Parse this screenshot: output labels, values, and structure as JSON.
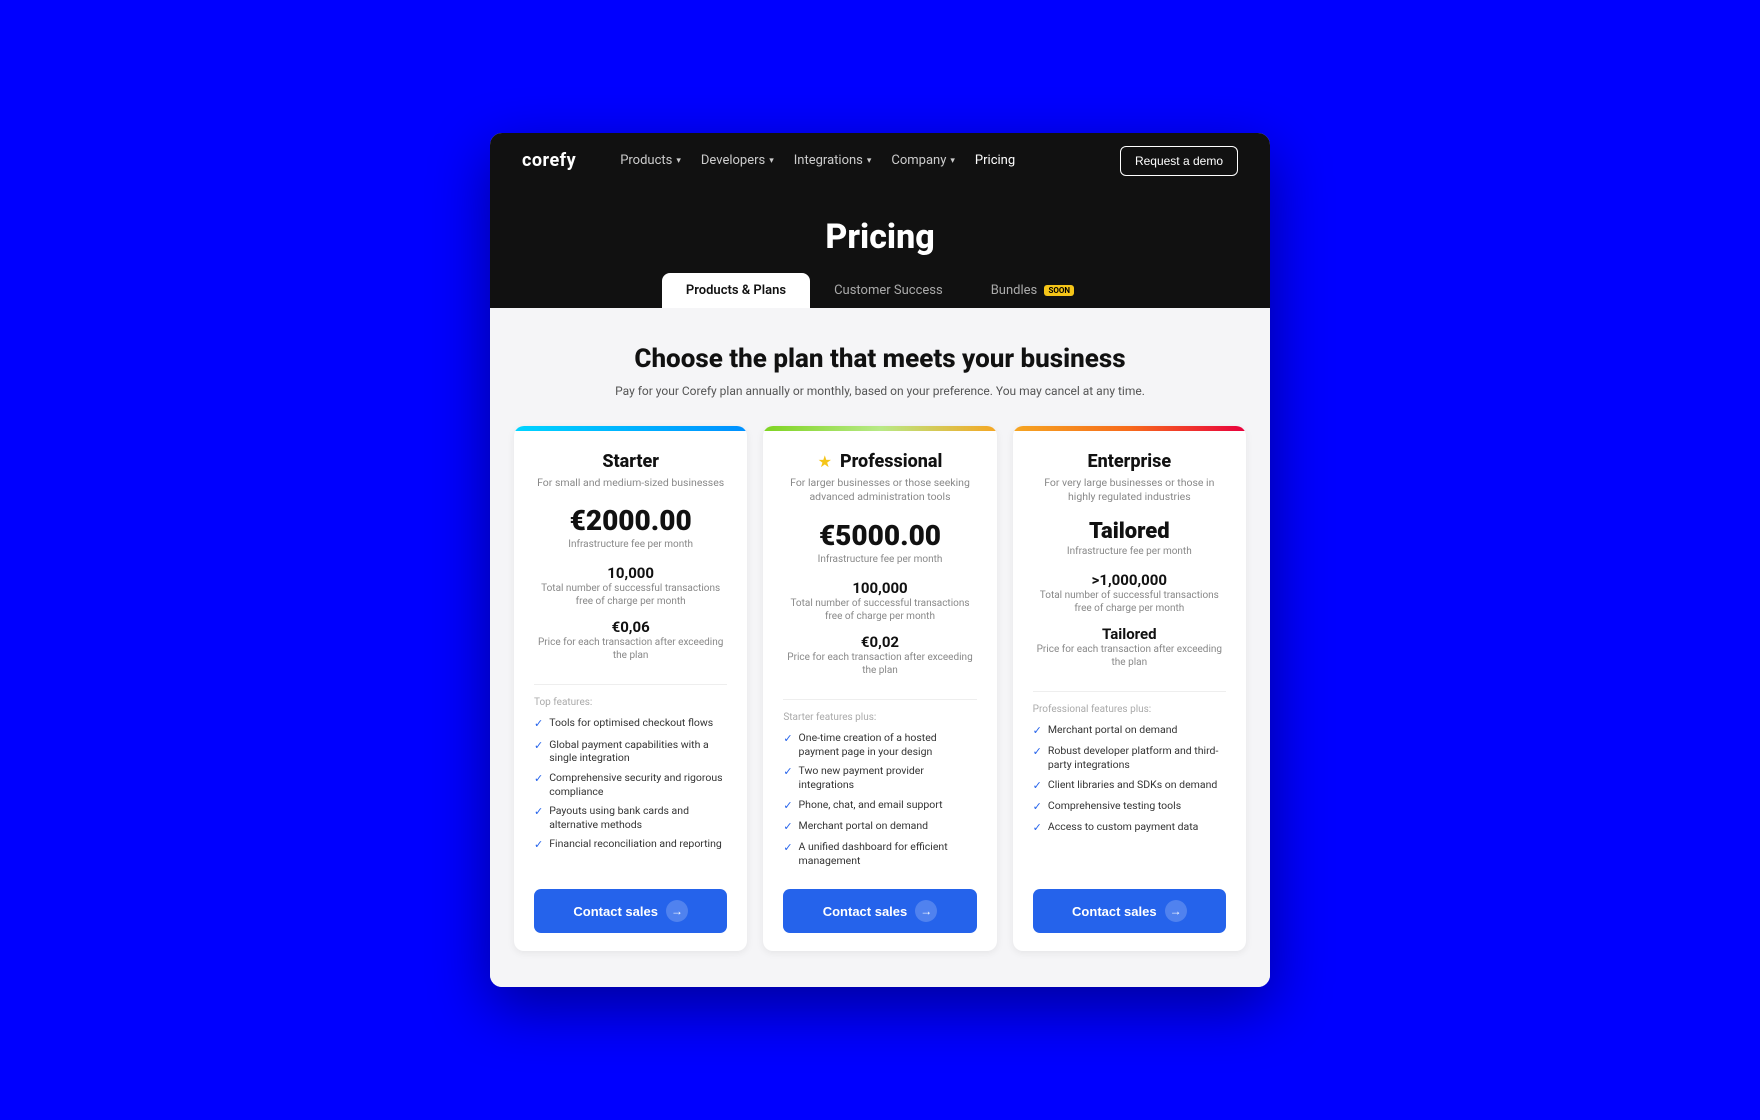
{
  "nav": {
    "logo": "corefy",
    "items": [
      {
        "label": "Products",
        "hasDropdown": true
      },
      {
        "label": "Developers",
        "hasDropdown": true
      },
      {
        "label": "Integrations",
        "hasDropdown": true
      },
      {
        "label": "Company",
        "hasDropdown": true
      },
      {
        "label": "Pricing",
        "hasDropdown": false
      }
    ],
    "cta": "Request a demo"
  },
  "hero": {
    "title": "Pricing"
  },
  "tabs": [
    {
      "id": "products-plans",
      "label": "Products & Plans",
      "active": true,
      "badge": null
    },
    {
      "id": "customer-success",
      "label": "Customer Success",
      "active": false,
      "badge": null
    },
    {
      "id": "bundles",
      "label": "Bundles",
      "active": false,
      "badge": "SOON"
    }
  ],
  "content": {
    "section_title": "Choose the plan that meets your business",
    "section_sub": "Pay for your Corefy plan annually or monthly, based on your preference. You may cancel at any time.",
    "plans": [
      {
        "id": "starter",
        "bar": "starter",
        "star": false,
        "name": "Starter",
        "desc": "For small and medium-sized businesses",
        "price": "€2000.00",
        "price_label": "Infrastructure fee per month",
        "stats": [
          {
            "value": "10,000",
            "desc": "Total number of successful transactions\nfree of charge per month"
          },
          {
            "value": "€0,06",
            "desc": "Price for each transaction after exceeding\nthe plan"
          }
        ],
        "features_label": "Top features:",
        "features": [
          "Tools for optimised checkout flows",
          "Global payment capabilities with a single integration",
          "Comprehensive security and rigorous compliance",
          "Payouts using bank cards and alternative methods",
          "Financial reconciliation and reporting"
        ],
        "btn_label": "Contact sales"
      },
      {
        "id": "professional",
        "bar": "professional",
        "star": true,
        "name": "Professional",
        "desc": "For larger businesses or those seeking advanced administration tools",
        "price": "€5000.00",
        "price_label": "Infrastructure fee per month",
        "stats": [
          {
            "value": "100,000",
            "desc": "Total number of successful transactions\nfree of charge per month"
          },
          {
            "value": "€0,02",
            "desc": "Price for each transaction after exceeding\nthe plan"
          }
        ],
        "features_label": "Starter features plus:",
        "features": [
          "One-time creation of a hosted payment page in your design",
          "Two new payment provider integrations",
          "Phone, chat, and email support",
          "Merchant portal on demand",
          "A unified dashboard for efficient management"
        ],
        "btn_label": "Contact sales"
      },
      {
        "id": "enterprise",
        "bar": "enterprise",
        "star": false,
        "name": "Enterprise",
        "desc": "For very large businesses or those in highly regulated industries",
        "price": "Tailored",
        "price_label": "Infrastructure fee per month",
        "stats": [
          {
            "value": ">1,000,000",
            "desc": "Total number of successful transactions\nfree of charge per month"
          },
          {
            "value": "Tailored",
            "desc": "Price for each transaction after exceeding\nthe plan"
          }
        ],
        "features_label": "Professional features plus:",
        "features": [
          "Merchant portal on demand",
          "Robust developer platform and third-party integrations",
          "Client libraries and SDKs on demand",
          "Comprehensive testing tools",
          "Access to custom payment data"
        ],
        "btn_label": "Contact sales"
      }
    ]
  }
}
